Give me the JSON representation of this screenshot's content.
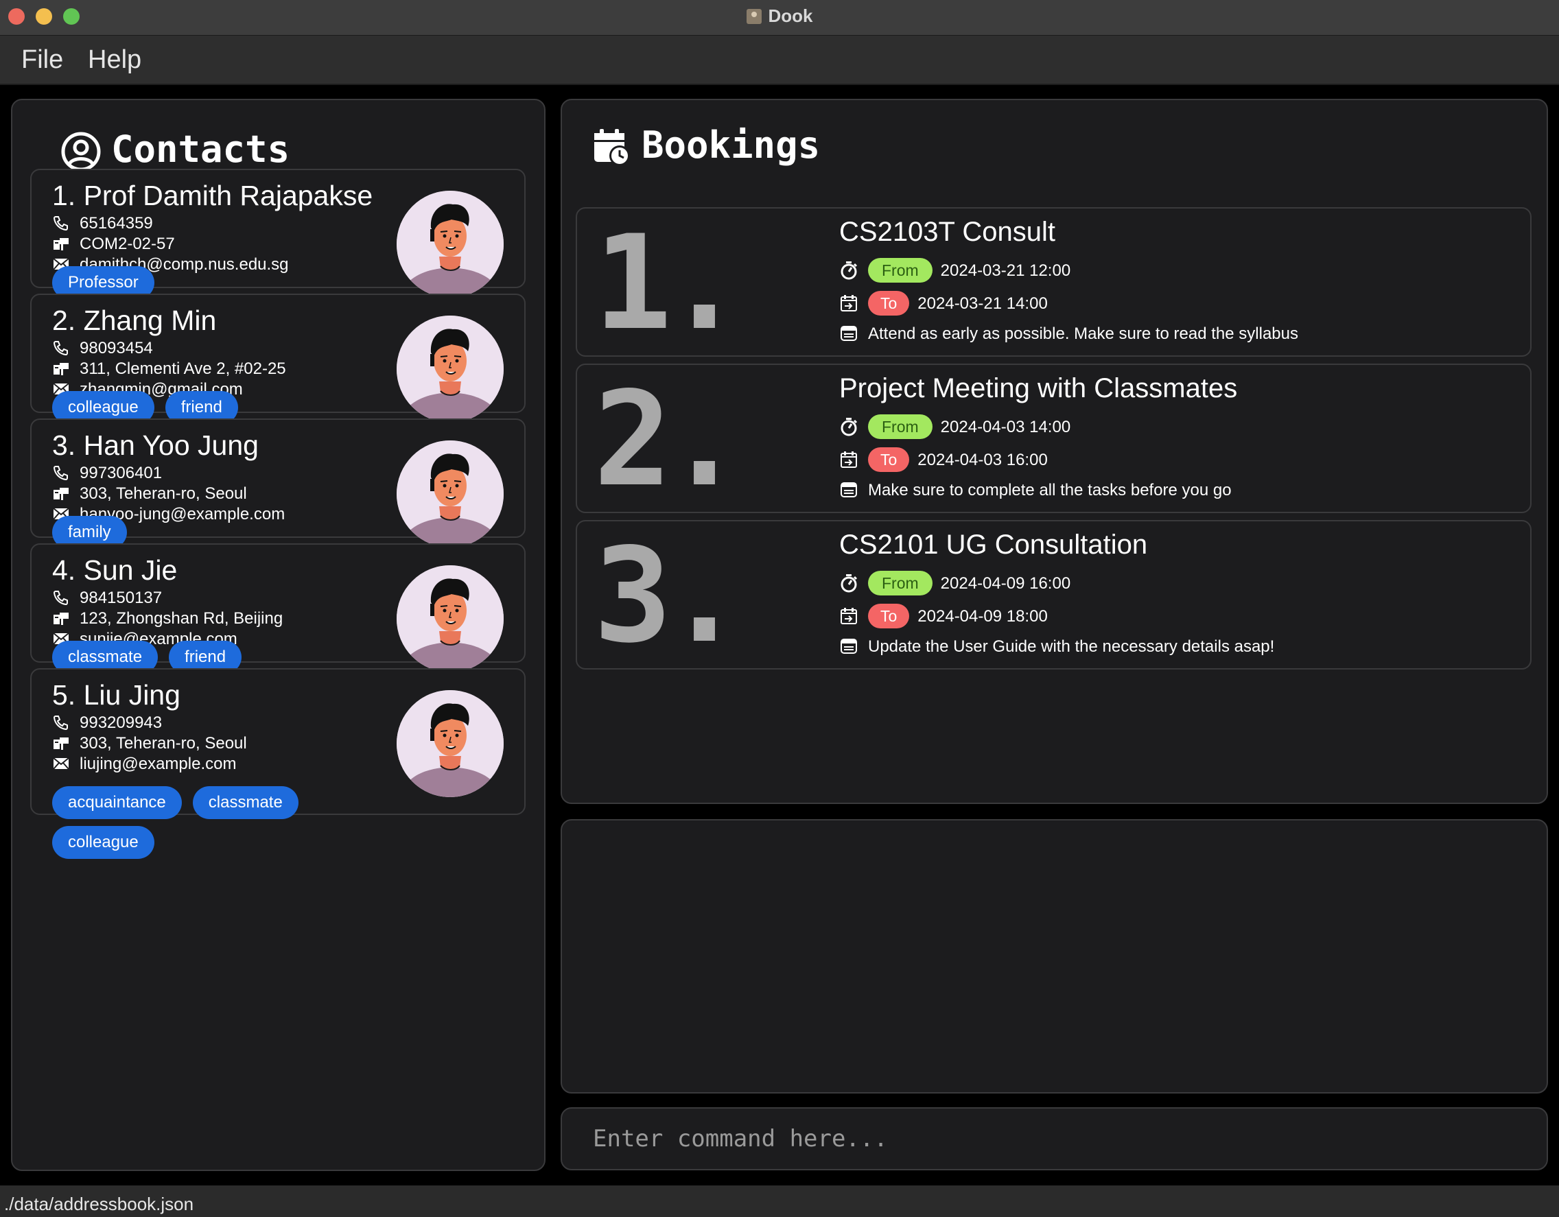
{
  "window": {
    "title": "Dook"
  },
  "menu": {
    "file": "File",
    "help": "Help"
  },
  "contacts": {
    "title": "Contacts",
    "items": [
      {
        "name": "1. Prof Damith Rajapakse",
        "phone": "65164359",
        "address": "COM2-02-57",
        "email": "damithch@comp.nus.edu.sg",
        "tags": [
          "Professor"
        ]
      },
      {
        "name": "2. Zhang Min",
        "phone": "98093454",
        "address": "311, Clementi Ave 2, #02-25",
        "email": "zhangmin@gmail.com",
        "tags": [
          "colleague",
          "friend"
        ]
      },
      {
        "name": "3. Han Yoo Jung",
        "phone": "997306401",
        "address": "303, Teheran-ro, Seoul",
        "email": "hanyoo-jung@example.com",
        "tags": [
          "family"
        ]
      },
      {
        "name": "4. Sun Jie",
        "phone": "984150137",
        "address": "123, Zhongshan Rd, Beijing",
        "email": "sunjie@example.com",
        "tags": [
          "classmate",
          "friend"
        ]
      },
      {
        "name": "5. Liu Jing",
        "phone": "993209943",
        "address": "303, Teheran-ro, Seoul",
        "email": "liujing@example.com",
        "tags": [
          "acquaintance",
          "classmate",
          "colleague"
        ]
      }
    ]
  },
  "bookings": {
    "title": "Bookings",
    "from_label": "From",
    "to_label": "To",
    "items": [
      {
        "index": "1.",
        "title": "CS2103T Consult",
        "from": "2024-03-21 12:00",
        "to": "2024-03-21 14:00",
        "note": "Attend as early as possible. Make sure to read the syllabus"
      },
      {
        "index": "2.",
        "title": "Project Meeting with Classmates",
        "from": "2024-04-03 14:00",
        "to": "2024-04-03 16:00",
        "note": "Make sure to complete all the tasks before you go"
      },
      {
        "index": "3.",
        "title": "CS2101 UG Consultation",
        "from": "2024-04-09 16:00",
        "to": "2024-04-09 18:00",
        "note": "Update the User Guide with the necessary details asap!"
      }
    ]
  },
  "command": {
    "placeholder": "Enter command here...",
    "value": ""
  },
  "status": {
    "path": "./data/addressbook.json"
  },
  "colors": {
    "tag": "#1e6bdc",
    "from_pill": "#a3e85f",
    "to_pill": "#f46565",
    "panel_bg": "#1c1c1e"
  }
}
